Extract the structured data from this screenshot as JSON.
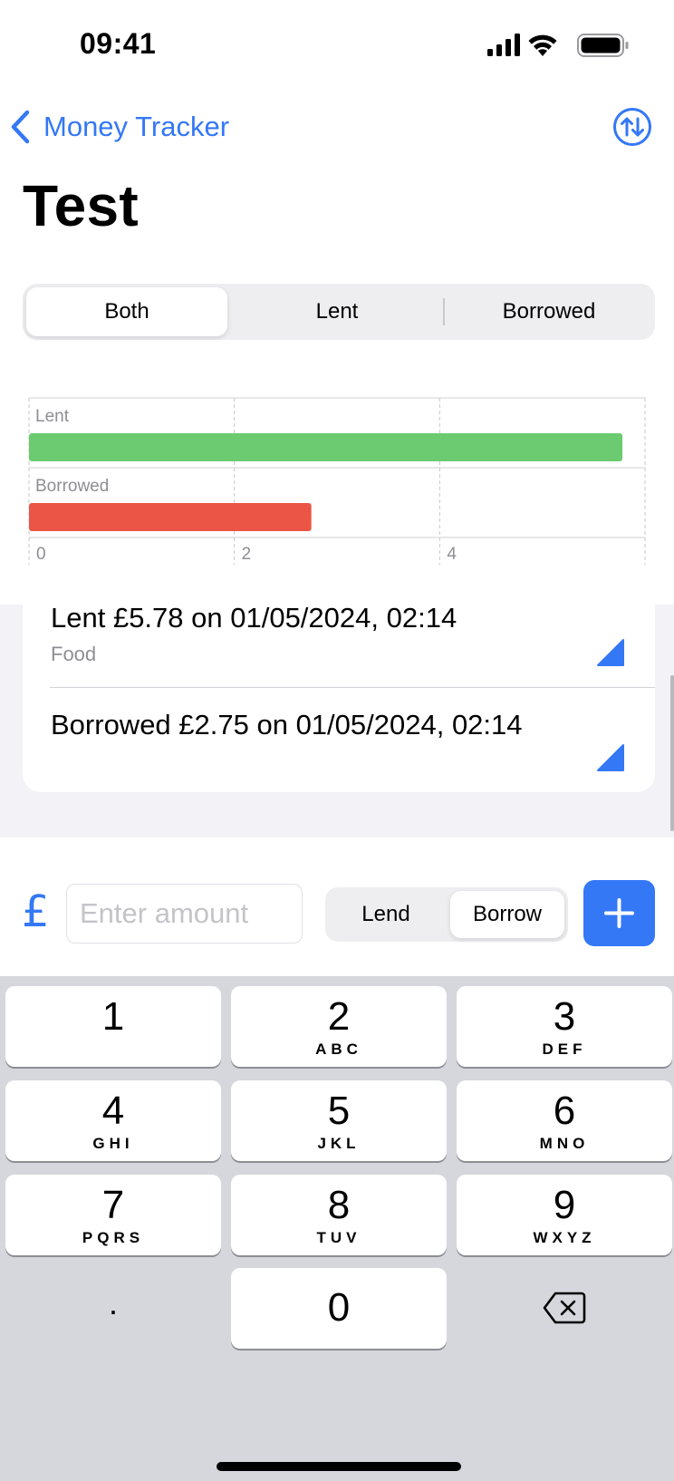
{
  "status_bar": {
    "time": "09:41"
  },
  "nav": {
    "back_label": "Money Tracker",
    "title": "Test"
  },
  "filter": {
    "options": [
      "Both",
      "Lent",
      "Borrowed"
    ],
    "selected": "Both"
  },
  "chart_data": {
    "type": "bar",
    "orientation": "horizontal",
    "categories": [
      "Lent",
      "Borrowed"
    ],
    "values": [
      5.78,
      2.75
    ],
    "colors": [
      "#6ccb70",
      "#eb5545"
    ],
    "x_ticks": [
      "0",
      "2",
      "4"
    ],
    "xlim": [
      0,
      6
    ],
    "grid": true
  },
  "transactions": [
    {
      "title": "Lent £5.78 on 01/05/2024, 02:14",
      "category": "Food"
    },
    {
      "title": "Borrowed £2.75 on 01/05/2024, 02:14",
      "category": ""
    }
  ],
  "entry": {
    "currency_symbol": "£",
    "amount_placeholder": "Enter amount",
    "mode_options": [
      "Lend",
      "Borrow"
    ],
    "mode_selected": "Borrow"
  },
  "keyboard": {
    "keys": [
      {
        "digit": "1",
        "letters": ""
      },
      {
        "digit": "2",
        "letters": "ABC"
      },
      {
        "digit": "3",
        "letters": "DEF"
      },
      {
        "digit": "4",
        "letters": "GHI"
      },
      {
        "digit": "5",
        "letters": "JKL"
      },
      {
        "digit": "6",
        "letters": "MNO"
      },
      {
        "digit": "7",
        "letters": "PQRS"
      },
      {
        "digit": "8",
        "letters": "TUV"
      },
      {
        "digit": "9",
        "letters": "WXYZ"
      },
      {
        "digit": "0",
        "letters": ""
      }
    ],
    "decimal": "."
  },
  "colors": {
    "accent": "#3478f6",
    "lent": "#6ccb70",
    "borrowed": "#eb5545"
  }
}
